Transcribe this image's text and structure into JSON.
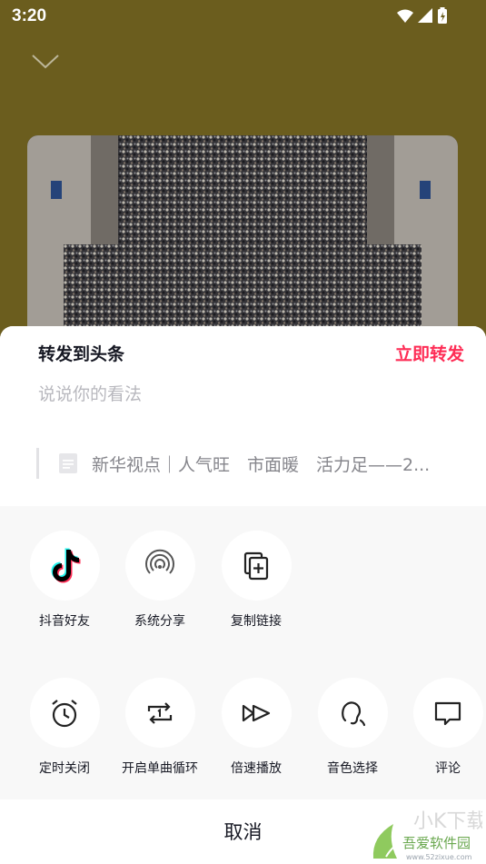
{
  "status_bar": {
    "time": "3:20"
  },
  "repost": {
    "title": "转发到头条",
    "action": "立即转发",
    "placeholder": "说说你的看法",
    "quote": "新华视点｜人气旺　市面暖　活力足——2..."
  },
  "share_row": [
    {
      "label": "抖音好友",
      "icon": "douyin-icon"
    },
    {
      "label": "系统分享",
      "icon": "system-share-icon"
    },
    {
      "label": "复制链接",
      "icon": "copy-link-icon"
    }
  ],
  "function_row": [
    {
      "label": "定时关闭",
      "icon": "alarm-clock-icon"
    },
    {
      "label": "开启单曲循环",
      "icon": "repeat-one-icon"
    },
    {
      "label": "倍速播放",
      "icon": "speed-icon"
    },
    {
      "label": "音色选择",
      "icon": "voice-icon"
    },
    {
      "label": "评论",
      "icon": "comment-icon"
    }
  ],
  "cancel_label": "取消",
  "watermark": {
    "brand": "吾爱软件园",
    "url": "www.52zixue.com"
  },
  "colors": {
    "accent": "#fe2c55",
    "background": "#6b5d1e"
  }
}
